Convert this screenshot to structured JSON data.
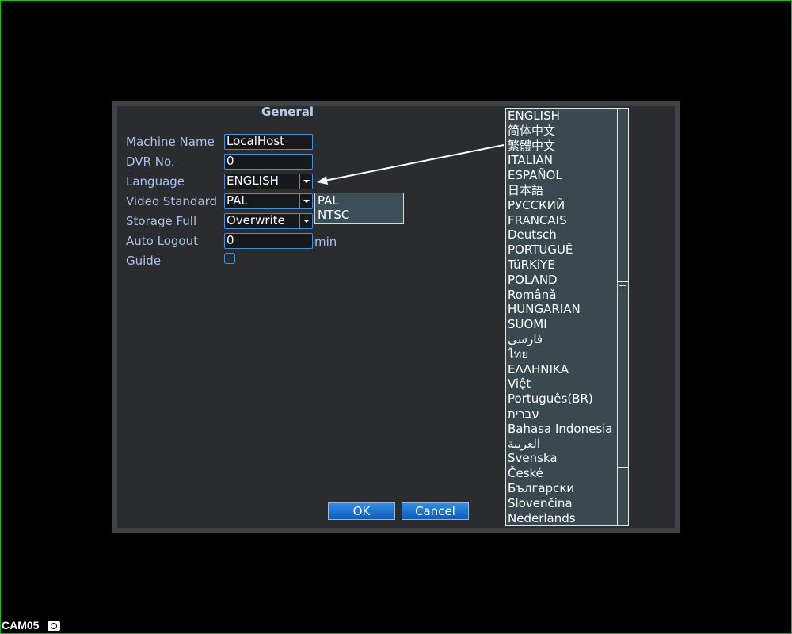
{
  "dialog": {
    "title": "General",
    "fields": {
      "machine_name": {
        "label": "Machine Name",
        "value": "LocalHost"
      },
      "dvr_no": {
        "label": "DVR No.",
        "value": "0"
      },
      "language": {
        "label": "Language",
        "value": "ENGLISH"
      },
      "video_standard": {
        "label": "Video Standard",
        "value": "PAL"
      },
      "storage_full": {
        "label": "Storage Full",
        "value": "Overwrite"
      },
      "auto_logout": {
        "label": "Auto Logout",
        "value": "0",
        "unit": "min"
      },
      "guide": {
        "label": "Guide",
        "checked": false
      }
    },
    "video_standard_options": [
      "PAL",
      "NTSC"
    ],
    "buttons": {
      "ok": "OK",
      "cancel": "Cancel"
    }
  },
  "language_options": [
    "ENGLISH",
    "简体中文",
    "繁體中文",
    "ITALIAN",
    "ESPAÑOL",
    "日本語",
    "РУССКИЙ",
    "FRANCAIS",
    "Deutsch",
    "PORTUGUÊ",
    "TüRKiYE",
    "POLAND",
    "Românǎ",
    "HUNGARIAN",
    "SUOMI",
    "فارسی",
    "ไทย",
    "ΕΛΛΗΝΙΚΑ",
    "Việt",
    "Português(BR)",
    "עברית",
    "Bahasa Indonesia",
    "العربية",
    "Svenska",
    "České",
    "Български",
    "Slovenčina",
    "Nederlands"
  ],
  "overlay": {
    "camera_label": "CAM05",
    "camera_icon": "camera-icon"
  },
  "colors": {
    "label": "#a9c1ea",
    "field_border": "#4a90d8",
    "button": "#1b6fd0",
    "frame": "#1cb81c"
  }
}
